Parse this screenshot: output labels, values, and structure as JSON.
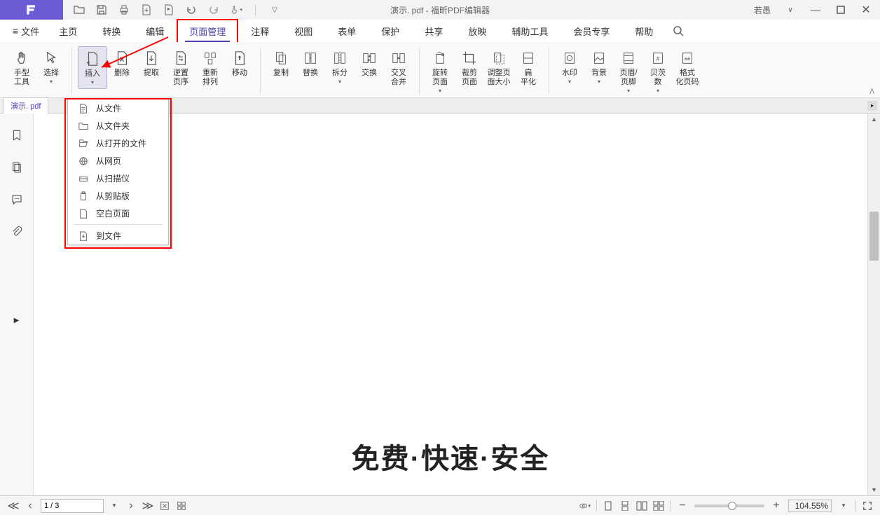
{
  "title_bar": {
    "document": "演示. pdf",
    "app": "福昕PDF编辑器",
    "user": "若愚"
  },
  "menu": {
    "file": "文件",
    "tabs": [
      "主页",
      "转换",
      "编辑",
      "页面管理",
      "注释",
      "视图",
      "表单",
      "保护",
      "共享",
      "放映",
      "辅助工具",
      "会员专享",
      "帮助"
    ],
    "active_index": 3
  },
  "ribbon": {
    "hand_tool": "手型\n工具",
    "select": "选择",
    "insert": "插入",
    "delete": "删除",
    "extract": "提取",
    "reverse": "逆置\n页序",
    "rearrange": "重新\n排列",
    "move": "移动",
    "duplicate": "复制",
    "replace": "替换",
    "split": "拆分",
    "swap": "交换",
    "merge": "交叉\n合并",
    "rotate": "旋转\n页面",
    "crop": "裁剪\n页面",
    "resize": "调整页\n面大小",
    "flatten": "扁\n平化",
    "watermark": "水印",
    "background": "背景",
    "header_footer": "页眉/\n页脚",
    "page_number": "贝茨\n数",
    "format_number": "格式\n化页码"
  },
  "tab": {
    "name": "演示. pdf"
  },
  "dropdown": {
    "from_file": "从文件",
    "from_folder": "从文件夹",
    "from_open": "从打开的文件",
    "from_web": "从网页",
    "from_scanner": "从扫描仪",
    "from_clipboard": "从剪贴板",
    "blank_page": "空白页面",
    "to_file": "到文件"
  },
  "page_content": {
    "headline": "免费·快速·安全"
  },
  "status": {
    "page": "1 / 3",
    "zoom": "104.55%"
  }
}
